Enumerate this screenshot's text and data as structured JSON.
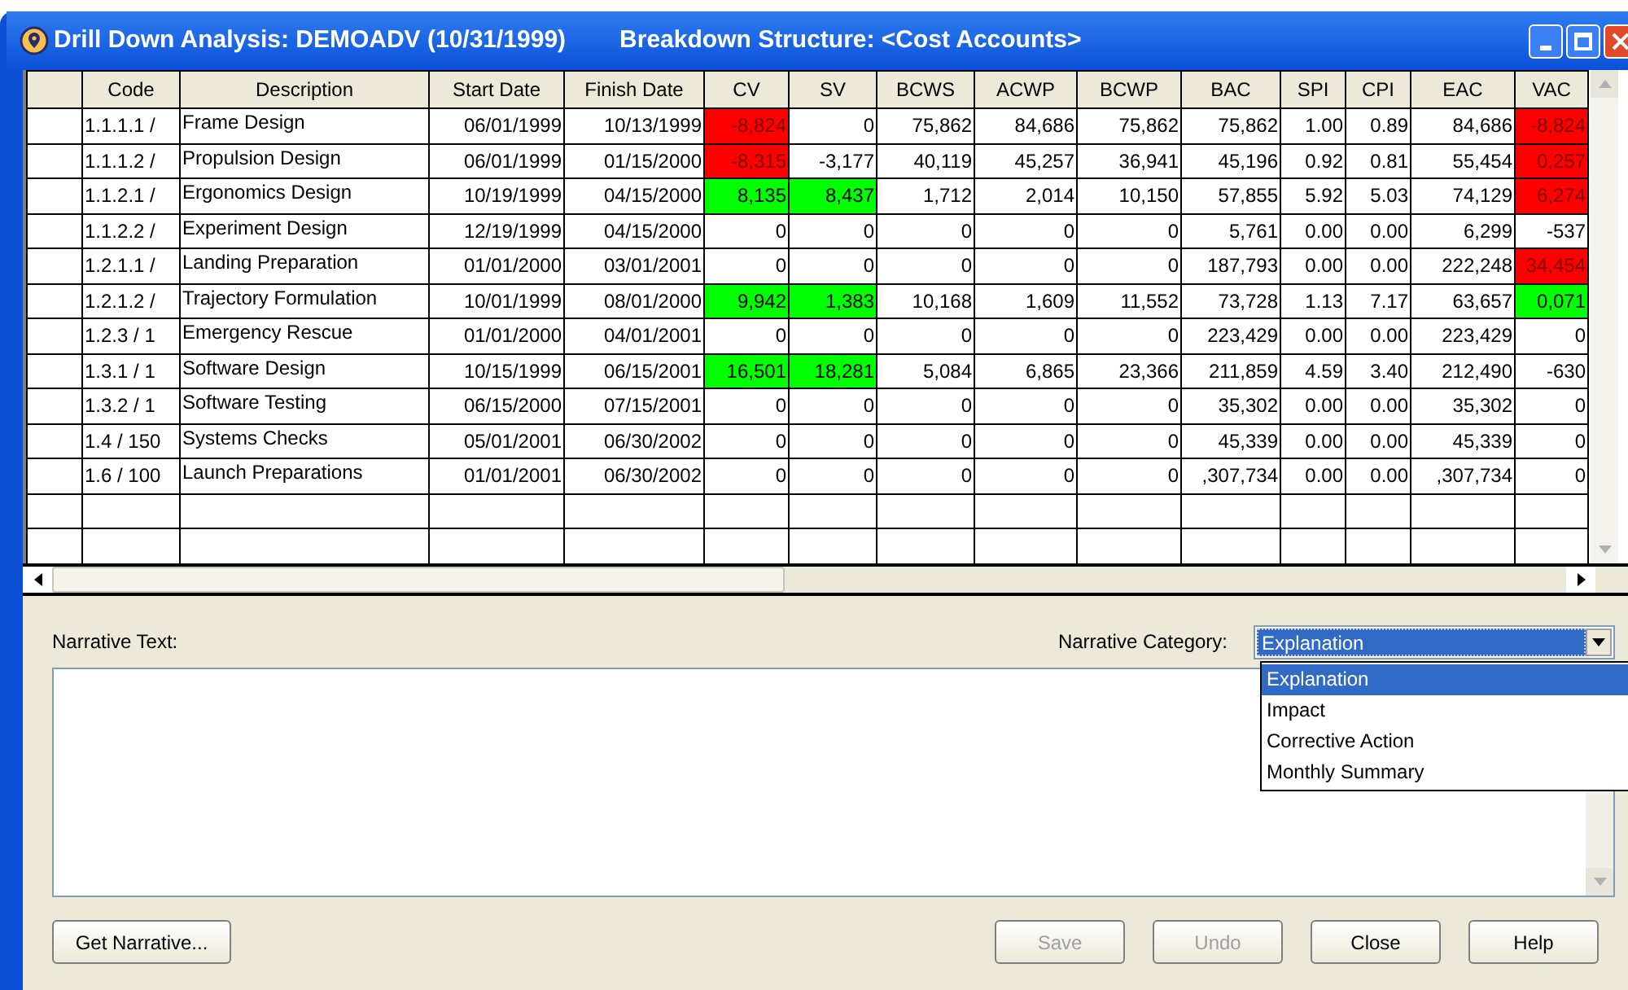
{
  "window": {
    "title": "Drill Down Analysis: DEMOADV (10/31/1999)",
    "subtitle": "Breakdown Structure: <Cost Accounts>"
  },
  "table": {
    "columns": [
      "Code",
      "Description",
      "Start Date",
      "Finish Date",
      "CV",
      "SV",
      "BCWS",
      "ACWP",
      "BCWP",
      "BAC",
      "SPI",
      "CPI",
      "EAC",
      "VAC"
    ],
    "rows": [
      {
        "cells": [
          {
            "text": "1.1.1.1 /"
          },
          {
            "text": "Frame Design"
          },
          {
            "text": "06/01/1999"
          },
          {
            "text": "10/13/1999"
          },
          {
            "text": "-8,824",
            "color": "#ff0000"
          },
          {
            "text": "0"
          },
          {
            "text": "75,862"
          },
          {
            "text": "84,686"
          },
          {
            "text": "75,862"
          },
          {
            "text": "75,862"
          },
          {
            "text": "1.00"
          },
          {
            "text": "0.89"
          },
          {
            "text": "84,686"
          },
          {
            "text": "-8,824",
            "color": "#ff0000"
          }
        ]
      },
      {
        "cells": [
          {
            "text": "1.1.1.2 /"
          },
          {
            "text": "Propulsion Design"
          },
          {
            "text": "06/01/1999"
          },
          {
            "text": "01/15/2000"
          },
          {
            "text": "-8,315",
            "color": "#ff0000"
          },
          {
            "text": "-3,177"
          },
          {
            "text": "40,119"
          },
          {
            "text": "45,257"
          },
          {
            "text": "36,941"
          },
          {
            "text": "45,196"
          },
          {
            "text": "0.92"
          },
          {
            "text": "0.81"
          },
          {
            "text": "55,454"
          },
          {
            "text": "0,257",
            "color": "#ff0000"
          }
        ]
      },
      {
        "cells": [
          {
            "text": "1.1.2.1 /"
          },
          {
            "text": "Ergonomics Design"
          },
          {
            "text": "10/19/1999"
          },
          {
            "text": "04/15/2000"
          },
          {
            "text": "8,135",
            "color": "#00ff00"
          },
          {
            "text": "8,437",
            "color": "#00ff00"
          },
          {
            "text": "1,712"
          },
          {
            "text": "2,014"
          },
          {
            "text": "10,150"
          },
          {
            "text": "57,855"
          },
          {
            "text": "5.92"
          },
          {
            "text": "5.03"
          },
          {
            "text": "74,129"
          },
          {
            "text": "6,274",
            "color": "#ff0000"
          }
        ]
      },
      {
        "cells": [
          {
            "text": "1.1.2.2 /"
          },
          {
            "text": "Experiment Design"
          },
          {
            "text": "12/19/1999"
          },
          {
            "text": "04/15/2000"
          },
          {
            "text": "0"
          },
          {
            "text": "0"
          },
          {
            "text": "0"
          },
          {
            "text": "0"
          },
          {
            "text": "0"
          },
          {
            "text": "5,761"
          },
          {
            "text": "0.00"
          },
          {
            "text": "0.00"
          },
          {
            "text": "6,299"
          },
          {
            "text": "-537"
          }
        ]
      },
      {
        "cells": [
          {
            "text": "1.2.1.1 /"
          },
          {
            "text": "Landing Preparation"
          },
          {
            "text": "01/01/2000"
          },
          {
            "text": "03/01/2001"
          },
          {
            "text": "0"
          },
          {
            "text": "0"
          },
          {
            "text": "0"
          },
          {
            "text": "0"
          },
          {
            "text": "0"
          },
          {
            "text": "187,793"
          },
          {
            "text": "0.00"
          },
          {
            "text": "0.00"
          },
          {
            "text": "222,248"
          },
          {
            "text": "34,454",
            "color": "#ff0000"
          }
        ]
      },
      {
        "cells": [
          {
            "text": "1.2.1.2 /"
          },
          {
            "text": "Trajectory Formulation"
          },
          {
            "text": "10/01/1999"
          },
          {
            "text": "08/01/2000"
          },
          {
            "text": "9,942",
            "color": "#00ff00"
          },
          {
            "text": "1,383",
            "color": "#00ff00"
          },
          {
            "text": "10,168"
          },
          {
            "text": "1,609"
          },
          {
            "text": "11,552"
          },
          {
            "text": "73,728"
          },
          {
            "text": "1.13"
          },
          {
            "text": "7.17"
          },
          {
            "text": "63,657"
          },
          {
            "text": "0,071",
            "color": "#00ff00"
          }
        ]
      },
      {
        "cells": [
          {
            "text": "1.2.3 / 1"
          },
          {
            "text": "Emergency Rescue"
          },
          {
            "text": "01/01/2000"
          },
          {
            "text": "04/01/2001"
          },
          {
            "text": "0"
          },
          {
            "text": "0"
          },
          {
            "text": "0"
          },
          {
            "text": "0"
          },
          {
            "text": "0"
          },
          {
            "text": "223,429"
          },
          {
            "text": "0.00"
          },
          {
            "text": "0.00"
          },
          {
            "text": "223,429"
          },
          {
            "text": "0"
          }
        ]
      },
      {
        "cells": [
          {
            "text": "1.3.1 / 1"
          },
          {
            "text": "Software Design"
          },
          {
            "text": "10/15/1999"
          },
          {
            "text": "06/15/2001"
          },
          {
            "text": "16,501",
            "color": "#00ff00"
          },
          {
            "text": "18,281",
            "color": "#00ff00"
          },
          {
            "text": "5,084"
          },
          {
            "text": "6,865"
          },
          {
            "text": "23,366"
          },
          {
            "text": "211,859"
          },
          {
            "text": "4.59"
          },
          {
            "text": "3.40"
          },
          {
            "text": "212,490"
          },
          {
            "text": "-630"
          }
        ]
      },
      {
        "cells": [
          {
            "text": "1.3.2 / 1"
          },
          {
            "text": "Software Testing"
          },
          {
            "text": "06/15/2000"
          },
          {
            "text": "07/15/2001"
          },
          {
            "text": "0"
          },
          {
            "text": "0"
          },
          {
            "text": "0"
          },
          {
            "text": "0"
          },
          {
            "text": "0"
          },
          {
            "text": "35,302"
          },
          {
            "text": "0.00"
          },
          {
            "text": "0.00"
          },
          {
            "text": "35,302"
          },
          {
            "text": "0"
          }
        ]
      },
      {
        "cells": [
          {
            "text": "1.4 / 150"
          },
          {
            "text": "Systems Checks"
          },
          {
            "text": "05/01/2001"
          },
          {
            "text": "06/30/2002"
          },
          {
            "text": "0"
          },
          {
            "text": "0"
          },
          {
            "text": "0"
          },
          {
            "text": "0"
          },
          {
            "text": "0"
          },
          {
            "text": "45,339"
          },
          {
            "text": "0.00"
          },
          {
            "text": "0.00"
          },
          {
            "text": "45,339"
          },
          {
            "text": "0"
          }
        ]
      },
      {
        "cells": [
          {
            "text": "1.6 / 100"
          },
          {
            "text": "Launch Preparations"
          },
          {
            "text": "01/01/2001"
          },
          {
            "text": "06/30/2002"
          },
          {
            "text": "0"
          },
          {
            "text": "0"
          },
          {
            "text": "0"
          },
          {
            "text": "0"
          },
          {
            "text": "0"
          },
          {
            "text": ",307,734"
          },
          {
            "text": "0.00"
          },
          {
            "text": "0.00"
          },
          {
            "text": ",307,734"
          },
          {
            "text": "0"
          }
        ]
      }
    ]
  },
  "narrative": {
    "label": "Narrative Text:",
    "category_label": "Narrative Category:",
    "category": {
      "value": "Explanation",
      "open": true,
      "options": [
        {
          "label": "Explanation",
          "selected": true
        },
        {
          "label": "Impact",
          "selected": false
        },
        {
          "label": "Corrective Action",
          "selected": false
        },
        {
          "label": "Monthly Summary",
          "selected": false
        }
      ]
    }
  },
  "buttons": [
    {
      "label": "Get Narrative...",
      "disabled": false
    },
    {
      "label": "Save",
      "disabled": true
    },
    {
      "label": "Undo",
      "disabled": true
    },
    {
      "label": "Close",
      "disabled": false
    },
    {
      "label": "Help",
      "disabled": false
    }
  ]
}
